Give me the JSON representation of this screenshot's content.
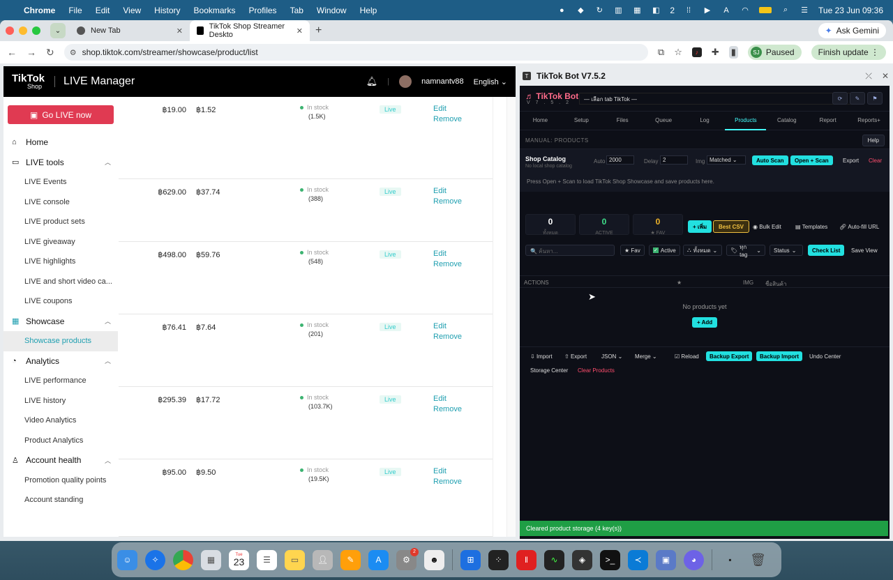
{
  "menubar": {
    "app": "Chrome",
    "items": [
      "File",
      "Edit",
      "View",
      "History",
      "Bookmarks",
      "Profiles",
      "Tab",
      "Window",
      "Help"
    ],
    "badge_count": "2",
    "clock": "Tue 23 Jun  09:36"
  },
  "browser": {
    "tabs": [
      {
        "title": "New Tab"
      },
      {
        "title": "TikTok Shop Streamer Deskto"
      }
    ],
    "ask_gemini": "Ask Gemini",
    "url": "shop.tiktok.com/streamer/showcase/product/list",
    "profile_initials": "SJ",
    "profile_status": "Paused",
    "finish_update": "Finish update"
  },
  "tiktok": {
    "brand": "TikTok",
    "brand_sub": "Shop",
    "title": "LIVE Manager",
    "username": "namnantv88",
    "language": "English",
    "go_live": "Go LIVE now",
    "sidebar": [
      {
        "label": "Home",
        "top": true,
        "icon": "home-icon"
      },
      {
        "label": "LIVE tools",
        "top": true,
        "icon": "live-icon",
        "chevron": true
      },
      {
        "label": "LIVE Events"
      },
      {
        "label": "LIVE console"
      },
      {
        "label": "LIVE product sets"
      },
      {
        "label": "LIVE giveaway"
      },
      {
        "label": "LIVE highlights"
      },
      {
        "label": "LIVE and short video ca..."
      },
      {
        "label": "LIVE coupons"
      },
      {
        "label": "Showcase",
        "top": true,
        "icon": "showcase-icon",
        "chevron": true
      },
      {
        "label": "Showcase products",
        "active": true
      },
      {
        "label": "Analytics",
        "top": true,
        "icon": "analytics-icon",
        "chevron": true
      },
      {
        "label": "LIVE performance"
      },
      {
        "label": "LIVE history"
      },
      {
        "label": "Video Analytics"
      },
      {
        "label": "Product Analytics"
      },
      {
        "label": "Account health",
        "top": true,
        "icon": "account-icon",
        "chevron": true
      },
      {
        "label": "Promotion quality points"
      },
      {
        "label": "Account standing"
      }
    ],
    "rows": [
      {
        "price": "฿19.00",
        "commission": "฿1.52",
        "stock_label": "In stock",
        "stock": "(1.5K)",
        "status": "Live",
        "edit": "Edit",
        "remove": "Remove"
      },
      {
        "price": "฿629.00",
        "commission": "฿37.74",
        "stock_label": "In stock",
        "stock": "(388)",
        "status": "Live",
        "edit": "Edit",
        "remove": "Remove"
      },
      {
        "price": "฿498.00",
        "commission": "฿59.76",
        "stock_label": "In stock",
        "stock": "(548)",
        "status": "Live",
        "edit": "Edit",
        "remove": "Remove"
      },
      {
        "price": "฿76.41",
        "commission": "฿7.64",
        "stock_label": "In stock",
        "stock": "(201)",
        "status": "Live",
        "edit": "Edit",
        "remove": "Remove"
      },
      {
        "price": "฿295.39",
        "commission": "฿17.72",
        "stock_label": "In stock",
        "stock": "(103.7K)",
        "status": "Live",
        "edit": "Edit",
        "remove": "Remove"
      },
      {
        "price": "฿95.00",
        "commission": "฿9.50",
        "stock_label": "In stock",
        "stock": "(19.5K)",
        "status": "Live",
        "edit": "Edit",
        "remove": "Remove"
      }
    ]
  },
  "bot": {
    "window_title": "TikTok Bot V7.5.2",
    "brand": "TikTok Bot",
    "version": "V 7 . 5 . 2",
    "tab_select": "— เลือก tab TikTok —",
    "nav": [
      "Home",
      "Setup",
      "Files",
      "Queue",
      "Log",
      "Products",
      "Catalog",
      "Report",
      "Reports+"
    ],
    "manual_label": "MANUAL: PRODUCTS",
    "help": "Help",
    "catalog_title": "Shop Catalog",
    "catalog_sub": "No local shop catalog",
    "auto_label": "Auto",
    "auto_value": "2000",
    "delay_label": "Delay",
    "delay_value": "2",
    "img_label": "Img",
    "img_value": "Matched",
    "auto_scan": "Auto Scan",
    "open_scan": "Open + Scan",
    "export": "Export",
    "clear": "Clear",
    "info": "Press Open + Scan to load TikTok Shop Showcase and save products here.",
    "stats": [
      {
        "value": "0",
        "label": "ทั้งหมด",
        "color": "#ffffff"
      },
      {
        "value": "0",
        "label": "ACTIVE",
        "color": "#3fe08a"
      },
      {
        "value": "0",
        "label": "★ FAV",
        "color": "#f0b429"
      }
    ],
    "add_short": "+ เพิ่ม",
    "best_csv": "Best CSV",
    "bulk_edit": "Bulk Edit",
    "templates": "Templates",
    "autofill": "Auto-fill URL",
    "search_placeholder": "🔍 ค้นหา...",
    "fav": "★ Fav",
    "active": "Active",
    "all_filter": "ทั้งหมด",
    "all_tag": "ทุก tag",
    "status_filter": "Status",
    "check_list": "Check List",
    "save_view": "Save View",
    "col_actions": "ACTIONS",
    "col_star": "★",
    "col_img": "IMG",
    "col_name": "ชื่อสินค้า",
    "no_products": "No products yet",
    "add": "+ Add",
    "import": "Import",
    "export2": "Export",
    "json": "JSON",
    "merge": "Merge",
    "reload": "Reload",
    "backup_export": "Backup Export",
    "backup_import": "Backup Import",
    "undo_center": "Undo Center",
    "storage_center": "Storage Center",
    "clear_products": "Clear Products",
    "status": "Cleared product storage (4 key(s))"
  },
  "dock": {
    "calendar_month": "Tue",
    "calendar_day": "23",
    "settings_badge": "2"
  }
}
